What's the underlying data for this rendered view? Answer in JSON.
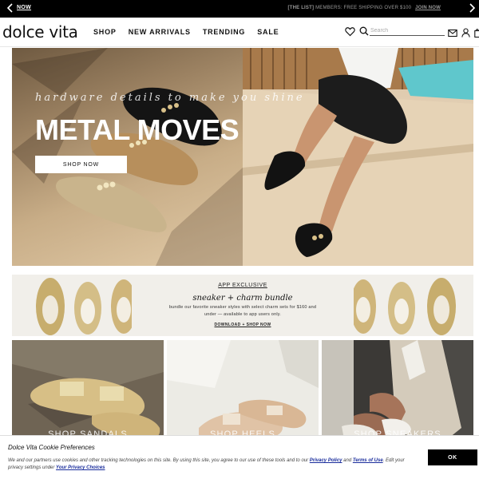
{
  "announcement": {
    "prev_label": "‹",
    "now_label": "NOW",
    "promo_lead": "[THE LIST]",
    "promo_text": "MEMBERS: FREE SHIPPING OVER $100",
    "promo_link": "JOIN NOW",
    "next_label": "›"
  },
  "header": {
    "logo": "dolce vita",
    "nav": [
      "SHOP",
      "NEW ARRIVALS",
      "TRENDING",
      "SALE"
    ],
    "search_placeholder": "Search",
    "icons": [
      "heart-icon",
      "search-icon",
      "mail-icon",
      "user-icon",
      "bag-icon"
    ]
  },
  "hero": {
    "tagline": "hardware details to make you shine",
    "title": "METAL MOVES",
    "cta": "SHOP NOW"
  },
  "app_banner": {
    "tag": "APP EXCLUSIVE",
    "title": "sneaker + charm bundle",
    "description": "bundle our favorite sneaker styles with select charm sets for $160 and under — available to app users only.",
    "link": "DOWNLOAD + SHOP NOW"
  },
  "tiles": [
    {
      "label": "SHOP SANDALS"
    },
    {
      "label": "SHOP HEELS"
    },
    {
      "label": "SHOP SNEAKERS"
    }
  ],
  "cookie": {
    "title": "Dolce Vita Cookie Preferences",
    "text_1": "We and our partners use cookies and other tracking technologies on this site. By using this site, you agree to our use of these tools and to our",
    "privacy_policy": "Privacy Policy",
    "text_2": "and",
    "terms": "Terms of Use",
    "text_3": ". Edit your privacy settings under",
    "privacy_choices": "Your Privacy Choices",
    "ok_label": "OK"
  },
  "colors": {
    "announce_bg": "#000000",
    "link_blue": "#1a2d9c",
    "cta_bg": "#000000"
  }
}
